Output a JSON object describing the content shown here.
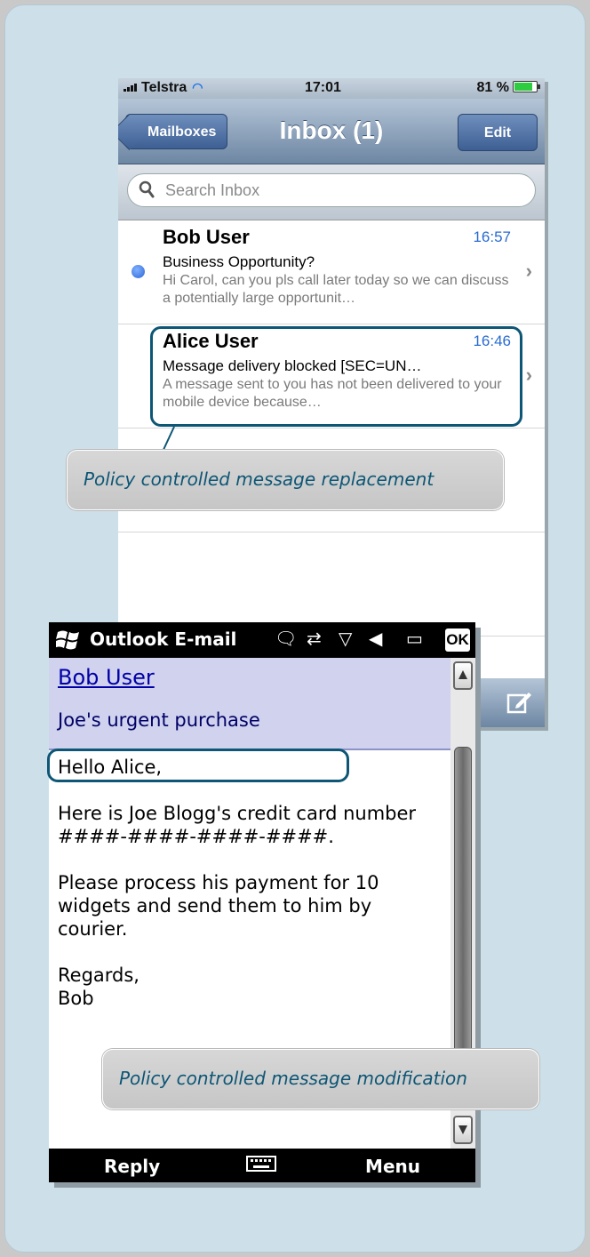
{
  "iphone": {
    "status": {
      "carrier": "Telstra",
      "time": "17:01",
      "battery": "81 %",
      "battery_level": 0.81
    },
    "nav": {
      "back_label": "Mailboxes",
      "title": "Inbox (1)",
      "edit_label": "Edit"
    },
    "search": {
      "placeholder": "Search Inbox"
    },
    "messages": [
      {
        "sender": "Bob User",
        "time": "16:57",
        "subject": "Business Opportunity?",
        "preview": "Hi Carol, can you pls call later today so we can discuss a potentially large opportunit…",
        "unread": true
      },
      {
        "sender": "Alice User",
        "time": "16:46",
        "subject": "Message delivery blocked [SEC=UN…",
        "preview": "A message sent to you has not been delivered to your mobile device because…",
        "unread": false
      }
    ]
  },
  "callouts": {
    "replacement": "Policy controlled message replacement",
    "modification": "Policy controlled message modification"
  },
  "wm": {
    "app_title": "Outlook E-mail",
    "ok_label": "OK",
    "from": "Bob User",
    "subject": "Joe's urgent purchase",
    "body": {
      "greeting": "Hello Alice,",
      "line1": "Here is Joe Blogg's credit card number",
      "masked": "####-####-####-####",
      "masked_suffix": ".",
      "line2": "Please process his payment for 10",
      "line3": "widgets and send them to him by",
      "line4": "courier.",
      "closing": "Regards,",
      "signature": "Bob"
    },
    "softkeys": {
      "left": "Reply",
      "right": "Menu"
    }
  },
  "colors": {
    "accent": "#0d5675",
    "link": "#0000a8",
    "time_blue": "#2a6bd1",
    "header_bg": "#d0d2ee"
  }
}
